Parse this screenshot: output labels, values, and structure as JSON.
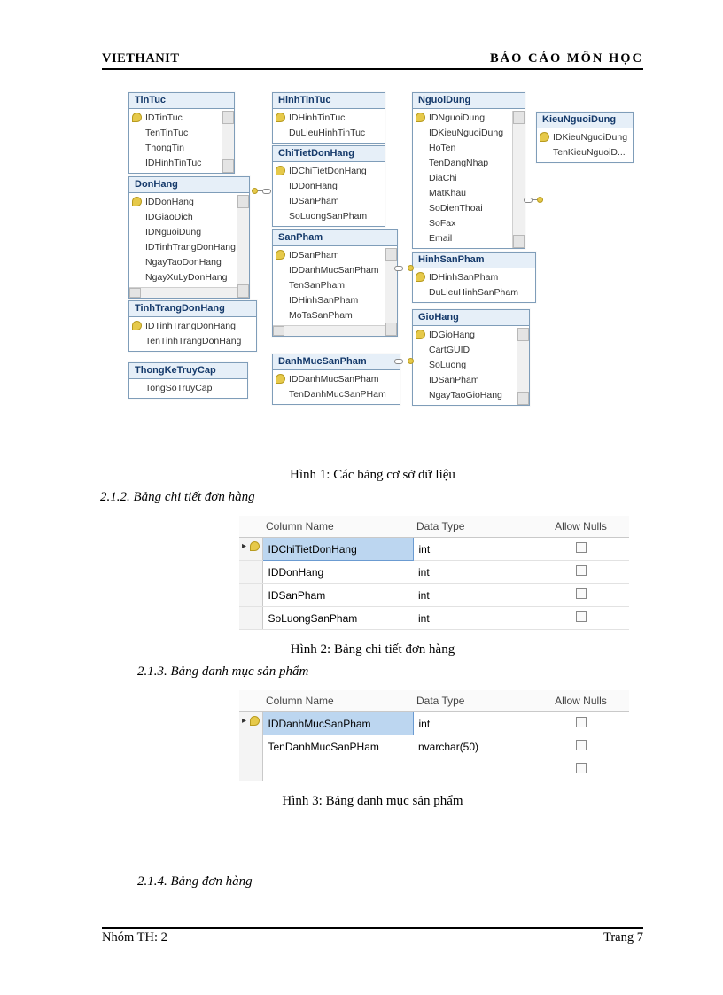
{
  "header": {
    "left": "VIETHANIT",
    "right": "BÁO CÁO MÔN HỌC"
  },
  "footer": {
    "left": "Nhóm TH: 2",
    "right": "Trang 7"
  },
  "captions": {
    "fig1": "Hình 1: Các bảng cơ sở dữ liệu",
    "fig2": "Hình 2: Bảng chi tiết đơn hàng",
    "fig3": "Hình 3: Bảng danh mục sản phẩm"
  },
  "sections": {
    "s212": "2.1.2. Bảng chi tiết đơn hàng",
    "s213": "2.1.3. Bảng danh mục sản phẩm",
    "s214": "2.1.4. Bảng đơn hàng"
  },
  "tableHeaders": {
    "col": "Column Name",
    "type": "Data Type",
    "null": "Allow Nulls"
  },
  "entities": {
    "TinTuc": {
      "title": "TinTuc",
      "cols": [
        "IDTinTuc",
        "TenTinTuc",
        "ThongTin",
        "IDHinhTinTuc"
      ],
      "pk": [
        0
      ]
    },
    "DonHang": {
      "title": "DonHang",
      "cols": [
        "IDDonHang",
        "IDGiaoDich",
        "IDNguoiDung",
        "IDTinhTrangDonHang",
        "NgayTaoDonHang",
        "NgayXuLyDonHang"
      ],
      "pk": [
        0
      ]
    },
    "TinhTrangDonHang": {
      "title": "TinhTrangDonHang",
      "cols": [
        "IDTinhTrangDonHang",
        "TenTinhTrangDonHang"
      ],
      "pk": [
        0
      ]
    },
    "ThongKeTruyCap": {
      "title": "ThongKeTruyCap",
      "cols": [
        "TongSoTruyCap"
      ],
      "pk": []
    },
    "HinhTinTuc": {
      "title": "HinhTinTuc",
      "cols": [
        "IDHinhTinTuc",
        "DuLieuHinhTinTuc"
      ],
      "pk": [
        0
      ]
    },
    "ChiTietDonHang": {
      "title": "ChiTietDonHang",
      "cols": [
        "IDChiTietDonHang",
        "IDDonHang",
        "IDSanPham",
        "SoLuongSanPham"
      ],
      "pk": [
        0
      ]
    },
    "SanPham": {
      "title": "SanPham",
      "cols": [
        "IDSanPham",
        "IDDanhMucSanPham",
        "TenSanPham",
        "IDHinhSanPham",
        "MoTaSanPham"
      ],
      "pk": [
        0
      ]
    },
    "DanhMucSanPham": {
      "title": "DanhMucSanPham",
      "cols": [
        "IDDanhMucSanPham",
        "TenDanhMucSanPHam"
      ],
      "pk": [
        0
      ]
    },
    "NguoiDung": {
      "title": "NguoiDung",
      "cols": [
        "IDNguoiDung",
        "IDKieuNguoiDung",
        "HoTen",
        "TenDangNhap",
        "DiaChi",
        "MatKhau",
        "SoDienThoai",
        "SoFax",
        "Email"
      ],
      "pk": [
        0
      ]
    },
    "KieuNguoiDung": {
      "title": "KieuNguoiDung",
      "cols": [
        "IDKieuNguoiDung",
        "TenKieuNguoiD..."
      ],
      "pk": [
        0
      ]
    },
    "HinhSanPham": {
      "title": "HinhSanPham",
      "cols": [
        "IDHinhSanPham",
        "DuLieuHinhSanPham"
      ],
      "pk": [
        0
      ]
    },
    "GioHang": {
      "title": "GioHang",
      "cols": [
        "IDGioHang",
        "CartGUID",
        "SoLuong",
        "IDSanPham",
        "NgayTaoGioHang"
      ],
      "pk": [
        0
      ]
    }
  },
  "table2": [
    {
      "name": "IDChiTietDonHang",
      "type": "int",
      "sel": true
    },
    {
      "name": "IDDonHang",
      "type": "int"
    },
    {
      "name": "IDSanPham",
      "type": "int"
    },
    {
      "name": "SoLuongSanPham",
      "type": "int"
    }
  ],
  "table3": [
    {
      "name": "IDDanhMucSanPham",
      "type": "int",
      "sel": true
    },
    {
      "name": "TenDanhMucSanPHam",
      "type": "nvarchar(50)"
    },
    {
      "name": "",
      "type": ""
    }
  ]
}
